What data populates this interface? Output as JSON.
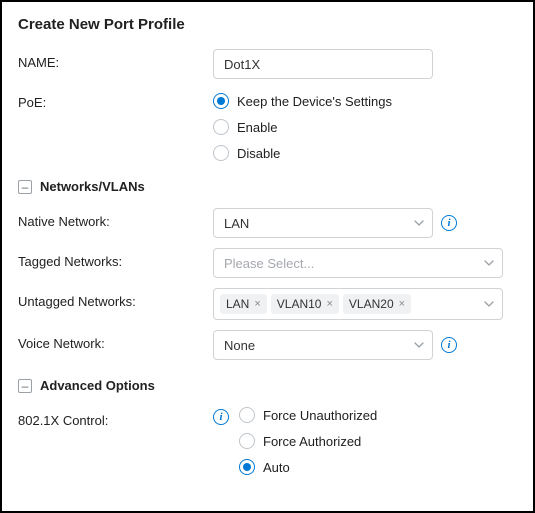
{
  "title": "Create New Port Profile",
  "name": {
    "label": "NAME:",
    "value": "Dot1X"
  },
  "poe": {
    "label": "PoE:",
    "options": [
      "Keep the Device's Settings",
      "Enable",
      "Disable"
    ],
    "selected": "Keep the Device's Settings"
  },
  "collapse_glyph": "–",
  "sections": {
    "networks": "Networks/VLANs",
    "advanced": "Advanced Options"
  },
  "native_network": {
    "label": "Native Network:",
    "value": "LAN"
  },
  "tagged_networks": {
    "label": "Tagged Networks:",
    "placeholder": "Please Select..."
  },
  "untagged_networks": {
    "label": "Untagged Networks:",
    "tags": [
      "LAN",
      "VLAN10",
      "VLAN20"
    ]
  },
  "voice_network": {
    "label": "Voice Network:",
    "value": "None"
  },
  "dot1x_control": {
    "label": "802.1X Control:",
    "options": [
      "Force Unauthorized",
      "Force Authorized",
      "Auto"
    ],
    "selected": "Auto"
  }
}
